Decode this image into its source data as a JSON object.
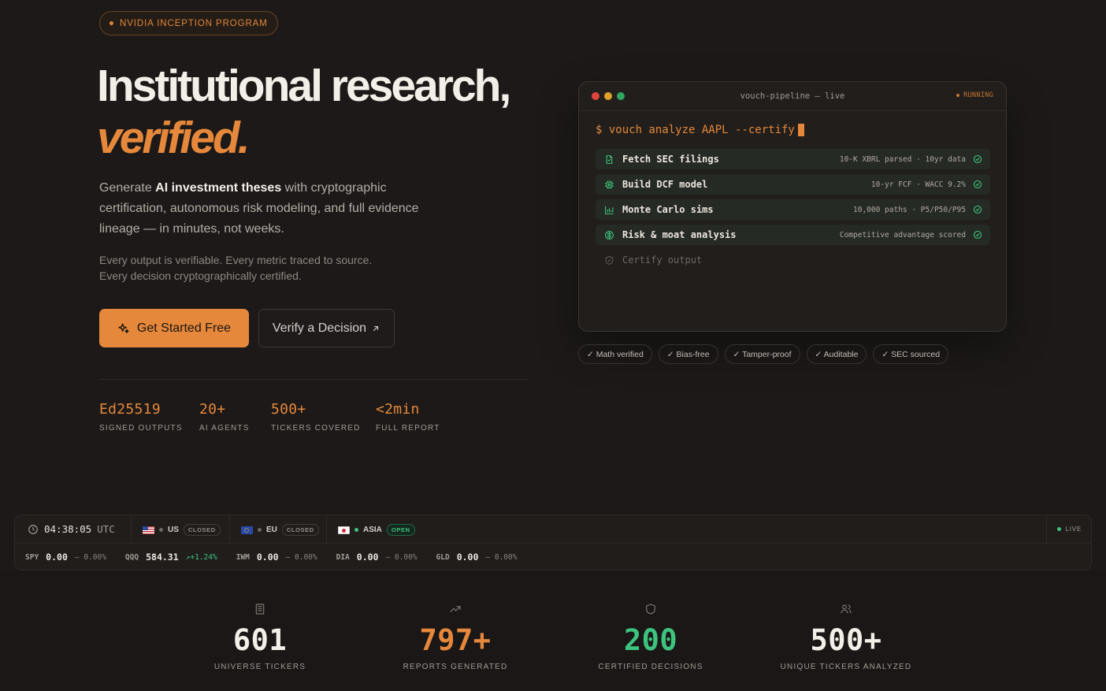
{
  "badge": {
    "label": "NVIDIA INCEPTION PROGRAM"
  },
  "hero": {
    "title_line1": "Institutional research,",
    "title_line2": "verified.",
    "lead_pre": "Generate ",
    "lead_bold": "AI investment theses",
    "lead_post": " with cryptographic certification, autonomous risk modeling, and full evidence lineage — in minutes, not weeks.",
    "sub_line1": "Every output is verifiable. Every metric traced to source.",
    "sub_line2": "Every decision cryptographically certified.",
    "cta_primary": "Get Started Free",
    "cta_secondary": "Verify a Decision",
    "stats": [
      {
        "value": "Ed25519",
        "label": "SIGNED OUTPUTS"
      },
      {
        "value": "20+",
        "label": "AI AGENTS"
      },
      {
        "value": "500+",
        "label": "TICKERS COVERED"
      },
      {
        "value": "<2min",
        "label": "FULL REPORT"
      }
    ]
  },
  "terminal": {
    "title": "vouch-pipeline — live",
    "status": "RUNNING",
    "command": "$ vouch analyze AAPL --certify",
    "steps": [
      {
        "icon": "file-icon",
        "name": "Fetch SEC filings",
        "meta": "10-K XBRL parsed · 10yr data",
        "status": "done"
      },
      {
        "icon": "chip-icon",
        "name": "Build DCF model",
        "meta": "10-yr FCF · WACC 9.2%",
        "status": "done"
      },
      {
        "icon": "bar-chart-icon",
        "name": "Monte Carlo sims",
        "meta": "10,000 paths · P5/P50/P95",
        "status": "done"
      },
      {
        "icon": "brain-icon",
        "name": "Risk & moat analysis",
        "meta": "Competitive advantage scored",
        "status": "done"
      },
      {
        "icon": "shield-check-icon",
        "name": "Certify output",
        "meta": "",
        "status": "pending"
      }
    ],
    "chips": [
      "✓ Math verified",
      "✓ Bias-free",
      "✓ Tamper-proof",
      "✓ Auditable",
      "✓ SEC sourced"
    ]
  },
  "market": {
    "time": "04:38:05",
    "tz": "UTC",
    "regions": [
      {
        "code": "US",
        "status": "CLOSED"
      },
      {
        "code": "EU",
        "status": "CLOSED"
      },
      {
        "code": "ASIA",
        "status": "OPEN"
      }
    ],
    "live_label": "LIVE",
    "quotes": [
      {
        "symbol": "SPY",
        "price": "0.00",
        "change": "— 0.00%",
        "trend": "flat"
      },
      {
        "symbol": "QQQ",
        "price": "584.31",
        "change": "↗+1.24%",
        "trend": "up"
      },
      {
        "symbol": "IWM",
        "price": "0.00",
        "change": "— 0.00%",
        "trend": "flat"
      },
      {
        "symbol": "DIA",
        "price": "0.00",
        "change": "— 0.00%",
        "trend": "flat"
      },
      {
        "symbol": "GLD",
        "price": "0.00",
        "change": "— 0.00%",
        "trend": "flat"
      }
    ]
  },
  "bottom_stats": [
    {
      "icon": "database-icon",
      "value": "601",
      "label": "UNIVERSE TICKERS",
      "color": "#f3eee8"
    },
    {
      "icon": "trending-up-icon",
      "value": "797+",
      "label": "REPORTS GENERATED",
      "color": "#e5883b"
    },
    {
      "icon": "shield-icon",
      "value": "200",
      "label": "CERTIFIED DECISIONS",
      "color": "#3cc47e"
    },
    {
      "icon": "users-icon",
      "value": "500+",
      "label": "UNIQUE TICKERS ANALYZED",
      "color": "#f3eee8"
    }
  ],
  "colors": {
    "accent": "#e5883b",
    "success": "#3cc47e",
    "background": "#1c1918"
  }
}
